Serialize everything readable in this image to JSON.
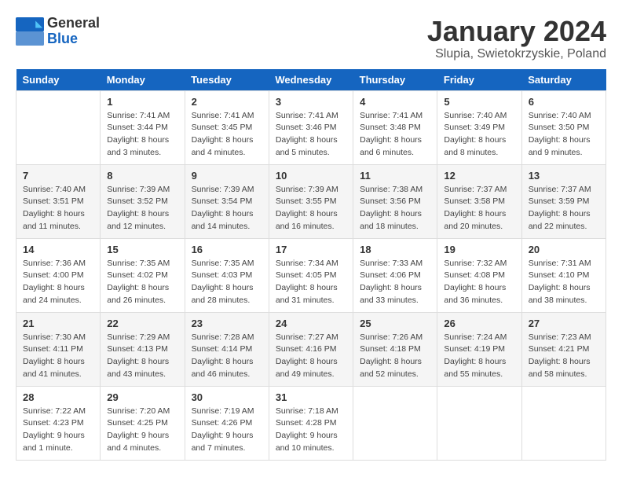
{
  "logo": {
    "line1": "General",
    "line2": "Blue"
  },
  "title": "January 2024",
  "location": "Slupia, Swietokrzyskie, Poland",
  "days_header": [
    "Sunday",
    "Monday",
    "Tuesday",
    "Wednesday",
    "Thursday",
    "Friday",
    "Saturday"
  ],
  "weeks": [
    [
      {
        "day": "",
        "sunrise": "",
        "sunset": "",
        "daylight": ""
      },
      {
        "day": "1",
        "sunrise": "Sunrise: 7:41 AM",
        "sunset": "Sunset: 3:44 PM",
        "daylight": "Daylight: 8 hours and 3 minutes."
      },
      {
        "day": "2",
        "sunrise": "Sunrise: 7:41 AM",
        "sunset": "Sunset: 3:45 PM",
        "daylight": "Daylight: 8 hours and 4 minutes."
      },
      {
        "day": "3",
        "sunrise": "Sunrise: 7:41 AM",
        "sunset": "Sunset: 3:46 PM",
        "daylight": "Daylight: 8 hours and 5 minutes."
      },
      {
        "day": "4",
        "sunrise": "Sunrise: 7:41 AM",
        "sunset": "Sunset: 3:48 PM",
        "daylight": "Daylight: 8 hours and 6 minutes."
      },
      {
        "day": "5",
        "sunrise": "Sunrise: 7:40 AM",
        "sunset": "Sunset: 3:49 PM",
        "daylight": "Daylight: 8 hours and 8 minutes."
      },
      {
        "day": "6",
        "sunrise": "Sunrise: 7:40 AM",
        "sunset": "Sunset: 3:50 PM",
        "daylight": "Daylight: 8 hours and 9 minutes."
      }
    ],
    [
      {
        "day": "7",
        "sunrise": "Sunrise: 7:40 AM",
        "sunset": "Sunset: 3:51 PM",
        "daylight": "Daylight: 8 hours and 11 minutes."
      },
      {
        "day": "8",
        "sunrise": "Sunrise: 7:39 AM",
        "sunset": "Sunset: 3:52 PM",
        "daylight": "Daylight: 8 hours and 12 minutes."
      },
      {
        "day": "9",
        "sunrise": "Sunrise: 7:39 AM",
        "sunset": "Sunset: 3:54 PM",
        "daylight": "Daylight: 8 hours and 14 minutes."
      },
      {
        "day": "10",
        "sunrise": "Sunrise: 7:39 AM",
        "sunset": "Sunset: 3:55 PM",
        "daylight": "Daylight: 8 hours and 16 minutes."
      },
      {
        "day": "11",
        "sunrise": "Sunrise: 7:38 AM",
        "sunset": "Sunset: 3:56 PM",
        "daylight": "Daylight: 8 hours and 18 minutes."
      },
      {
        "day": "12",
        "sunrise": "Sunrise: 7:37 AM",
        "sunset": "Sunset: 3:58 PM",
        "daylight": "Daylight: 8 hours and 20 minutes."
      },
      {
        "day": "13",
        "sunrise": "Sunrise: 7:37 AM",
        "sunset": "Sunset: 3:59 PM",
        "daylight": "Daylight: 8 hours and 22 minutes."
      }
    ],
    [
      {
        "day": "14",
        "sunrise": "Sunrise: 7:36 AM",
        "sunset": "Sunset: 4:00 PM",
        "daylight": "Daylight: 8 hours and 24 minutes."
      },
      {
        "day": "15",
        "sunrise": "Sunrise: 7:35 AM",
        "sunset": "Sunset: 4:02 PM",
        "daylight": "Daylight: 8 hours and 26 minutes."
      },
      {
        "day": "16",
        "sunrise": "Sunrise: 7:35 AM",
        "sunset": "Sunset: 4:03 PM",
        "daylight": "Daylight: 8 hours and 28 minutes."
      },
      {
        "day": "17",
        "sunrise": "Sunrise: 7:34 AM",
        "sunset": "Sunset: 4:05 PM",
        "daylight": "Daylight: 8 hours and 31 minutes."
      },
      {
        "day": "18",
        "sunrise": "Sunrise: 7:33 AM",
        "sunset": "Sunset: 4:06 PM",
        "daylight": "Daylight: 8 hours and 33 minutes."
      },
      {
        "day": "19",
        "sunrise": "Sunrise: 7:32 AM",
        "sunset": "Sunset: 4:08 PM",
        "daylight": "Daylight: 8 hours and 36 minutes."
      },
      {
        "day": "20",
        "sunrise": "Sunrise: 7:31 AM",
        "sunset": "Sunset: 4:10 PM",
        "daylight": "Daylight: 8 hours and 38 minutes."
      }
    ],
    [
      {
        "day": "21",
        "sunrise": "Sunrise: 7:30 AM",
        "sunset": "Sunset: 4:11 PM",
        "daylight": "Daylight: 8 hours and 41 minutes."
      },
      {
        "day": "22",
        "sunrise": "Sunrise: 7:29 AM",
        "sunset": "Sunset: 4:13 PM",
        "daylight": "Daylight: 8 hours and 43 minutes."
      },
      {
        "day": "23",
        "sunrise": "Sunrise: 7:28 AM",
        "sunset": "Sunset: 4:14 PM",
        "daylight": "Daylight: 8 hours and 46 minutes."
      },
      {
        "day": "24",
        "sunrise": "Sunrise: 7:27 AM",
        "sunset": "Sunset: 4:16 PM",
        "daylight": "Daylight: 8 hours and 49 minutes."
      },
      {
        "day": "25",
        "sunrise": "Sunrise: 7:26 AM",
        "sunset": "Sunset: 4:18 PM",
        "daylight": "Daylight: 8 hours and 52 minutes."
      },
      {
        "day": "26",
        "sunrise": "Sunrise: 7:24 AM",
        "sunset": "Sunset: 4:19 PM",
        "daylight": "Daylight: 8 hours and 55 minutes."
      },
      {
        "day": "27",
        "sunrise": "Sunrise: 7:23 AM",
        "sunset": "Sunset: 4:21 PM",
        "daylight": "Daylight: 8 hours and 58 minutes."
      }
    ],
    [
      {
        "day": "28",
        "sunrise": "Sunrise: 7:22 AM",
        "sunset": "Sunset: 4:23 PM",
        "daylight": "Daylight: 9 hours and 1 minute."
      },
      {
        "day": "29",
        "sunrise": "Sunrise: 7:20 AM",
        "sunset": "Sunset: 4:25 PM",
        "daylight": "Daylight: 9 hours and 4 minutes."
      },
      {
        "day": "30",
        "sunrise": "Sunrise: 7:19 AM",
        "sunset": "Sunset: 4:26 PM",
        "daylight": "Daylight: 9 hours and 7 minutes."
      },
      {
        "day": "31",
        "sunrise": "Sunrise: 7:18 AM",
        "sunset": "Sunset: 4:28 PM",
        "daylight": "Daylight: 9 hours and 10 minutes."
      },
      {
        "day": "",
        "sunrise": "",
        "sunset": "",
        "daylight": ""
      },
      {
        "day": "",
        "sunrise": "",
        "sunset": "",
        "daylight": ""
      },
      {
        "day": "",
        "sunrise": "",
        "sunset": "",
        "daylight": ""
      }
    ]
  ]
}
